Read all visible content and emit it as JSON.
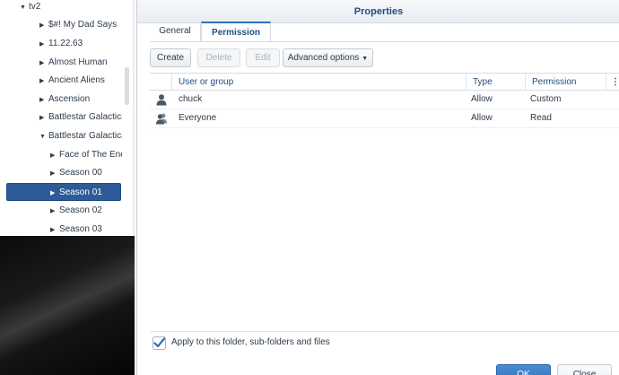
{
  "tree": {
    "items": [
      {
        "label": "tv2",
        "caret": "▼"
      },
      {
        "label": "$#! My Dad Says",
        "caret": "▶"
      },
      {
        "label": "11.22.63",
        "caret": "▶"
      },
      {
        "label": "Almost Human",
        "caret": "▶"
      },
      {
        "label": "Ancient Aliens",
        "caret": "▶"
      },
      {
        "label": "Ascension",
        "caret": "▶"
      },
      {
        "label": "Battlestar Galactica",
        "caret": "▶"
      },
      {
        "label": "Battlestar Galactica (",
        "caret": "▼"
      },
      {
        "label": "Face of The Ener",
        "caret": "▶"
      },
      {
        "label": "Season 00",
        "caret": "▶"
      },
      {
        "label": "Season 01",
        "caret": "▶"
      },
      {
        "label": "Season 02",
        "caret": "▶"
      },
      {
        "label": "Season 03",
        "caret": "▶"
      }
    ]
  },
  "dialog": {
    "title": "Properties",
    "tabs": [
      "General",
      "Permission"
    ],
    "toolbar": {
      "create": "Create",
      "delete": "Delete",
      "edit": "Edit",
      "advanced": "Advanced options"
    },
    "columns": [
      "User or group",
      "Type",
      "Permission",
      "⋮"
    ],
    "rows": [
      {
        "user": "chuck",
        "type": "Allow",
        "permission": "Custom",
        "icon": "user-icon"
      },
      {
        "user": "Everyone",
        "type": "Allow",
        "permission": "Read",
        "icon": "group-icon"
      }
    ],
    "apply_label": "Apply to this folder, sub-folders and files",
    "ok": "OK",
    "close": "Close"
  },
  "colors": {
    "accent": "#2d5b98",
    "title_text": "#1e4d82",
    "primary_button": "#2f6fb7"
  }
}
